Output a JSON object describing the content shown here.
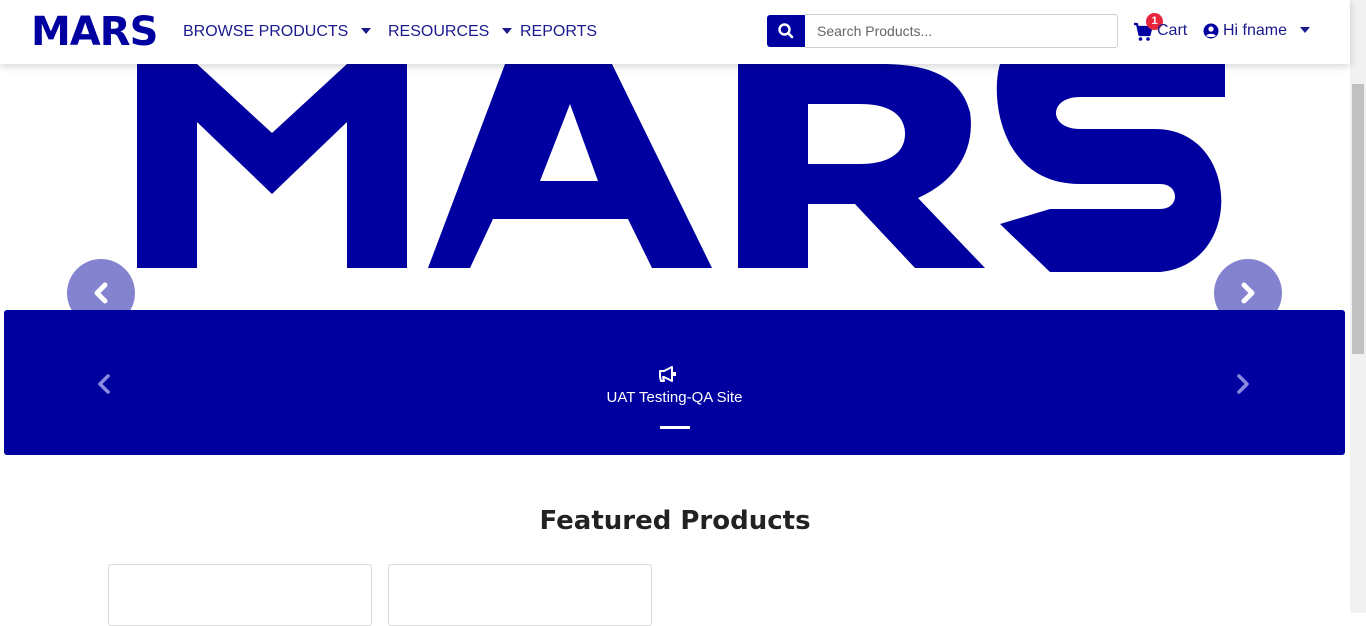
{
  "header": {
    "logo_text": "MARS",
    "nav": {
      "browse_products": "BROWSE PRODUCTS",
      "resources": "RESOURCES",
      "reports": "REPORTS"
    },
    "search": {
      "placeholder": "Search Products..."
    },
    "cart": {
      "label": "Cart",
      "count": "1"
    },
    "user": {
      "greeting": "Hi fname"
    }
  },
  "hero": {
    "logo_text": "MARS"
  },
  "banner": {
    "text": "UAT Testing-QA Site"
  },
  "featured": {
    "title": "Featured Products"
  },
  "colors": {
    "brand": "#0000a0",
    "badge": "#e8253d",
    "hero_arrow": "#8383d0"
  },
  "icons": [
    "search-icon",
    "cart-icon",
    "user-circle-icon",
    "chevron-left-icon",
    "chevron-right-icon",
    "megaphone-icon",
    "caret-down-icon"
  ]
}
